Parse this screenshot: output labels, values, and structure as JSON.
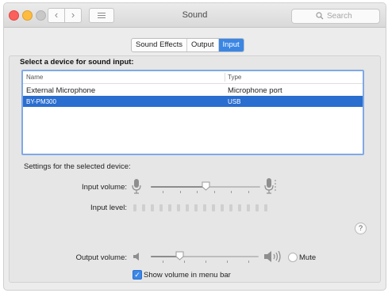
{
  "window": {
    "title": "Sound",
    "search_placeholder": "Search",
    "traffic_lights": [
      "close",
      "minimize",
      "zoom"
    ],
    "back_glyph": "‹",
    "forward_glyph": "›"
  },
  "tabs": [
    {
      "label": "Sound Effects",
      "active": false
    },
    {
      "label": "Output",
      "active": false
    },
    {
      "label": "Input",
      "active": true
    }
  ],
  "device_list": {
    "heading": "Select a device for sound input:",
    "columns": [
      "Name",
      "Type"
    ],
    "rows": [
      {
        "name": "External Microphone",
        "type": "Microphone port",
        "selected": false
      },
      {
        "name": "BY-PM300",
        "type": "USB",
        "selected": true
      }
    ]
  },
  "settings": {
    "heading": "Settings for the selected device:",
    "input_volume_label": "Input volume:",
    "input_volume_level": 0.5,
    "input_level_label": "Input level:",
    "input_level_value": 0,
    "help_glyph": "?"
  },
  "output": {
    "label": "Output volume:",
    "level": 0.27,
    "mute_label": "Mute",
    "mute_checked": false,
    "show_in_menu_bar_label": "Show volume in menu bar",
    "show_in_menu_bar_checked": true,
    "check_glyph": "✓"
  },
  "colors": {
    "accent": "#3a86e5",
    "selection": "#2a6ecf",
    "close": "#fc605c",
    "minimize": "#fdbc40"
  },
  "icons": [
    "search-icon",
    "grid-icon",
    "microphone-low-icon",
    "microphone-high-icon",
    "speaker-low-icon",
    "speaker-high-icon",
    "help-icon",
    "checkmark-icon"
  ]
}
